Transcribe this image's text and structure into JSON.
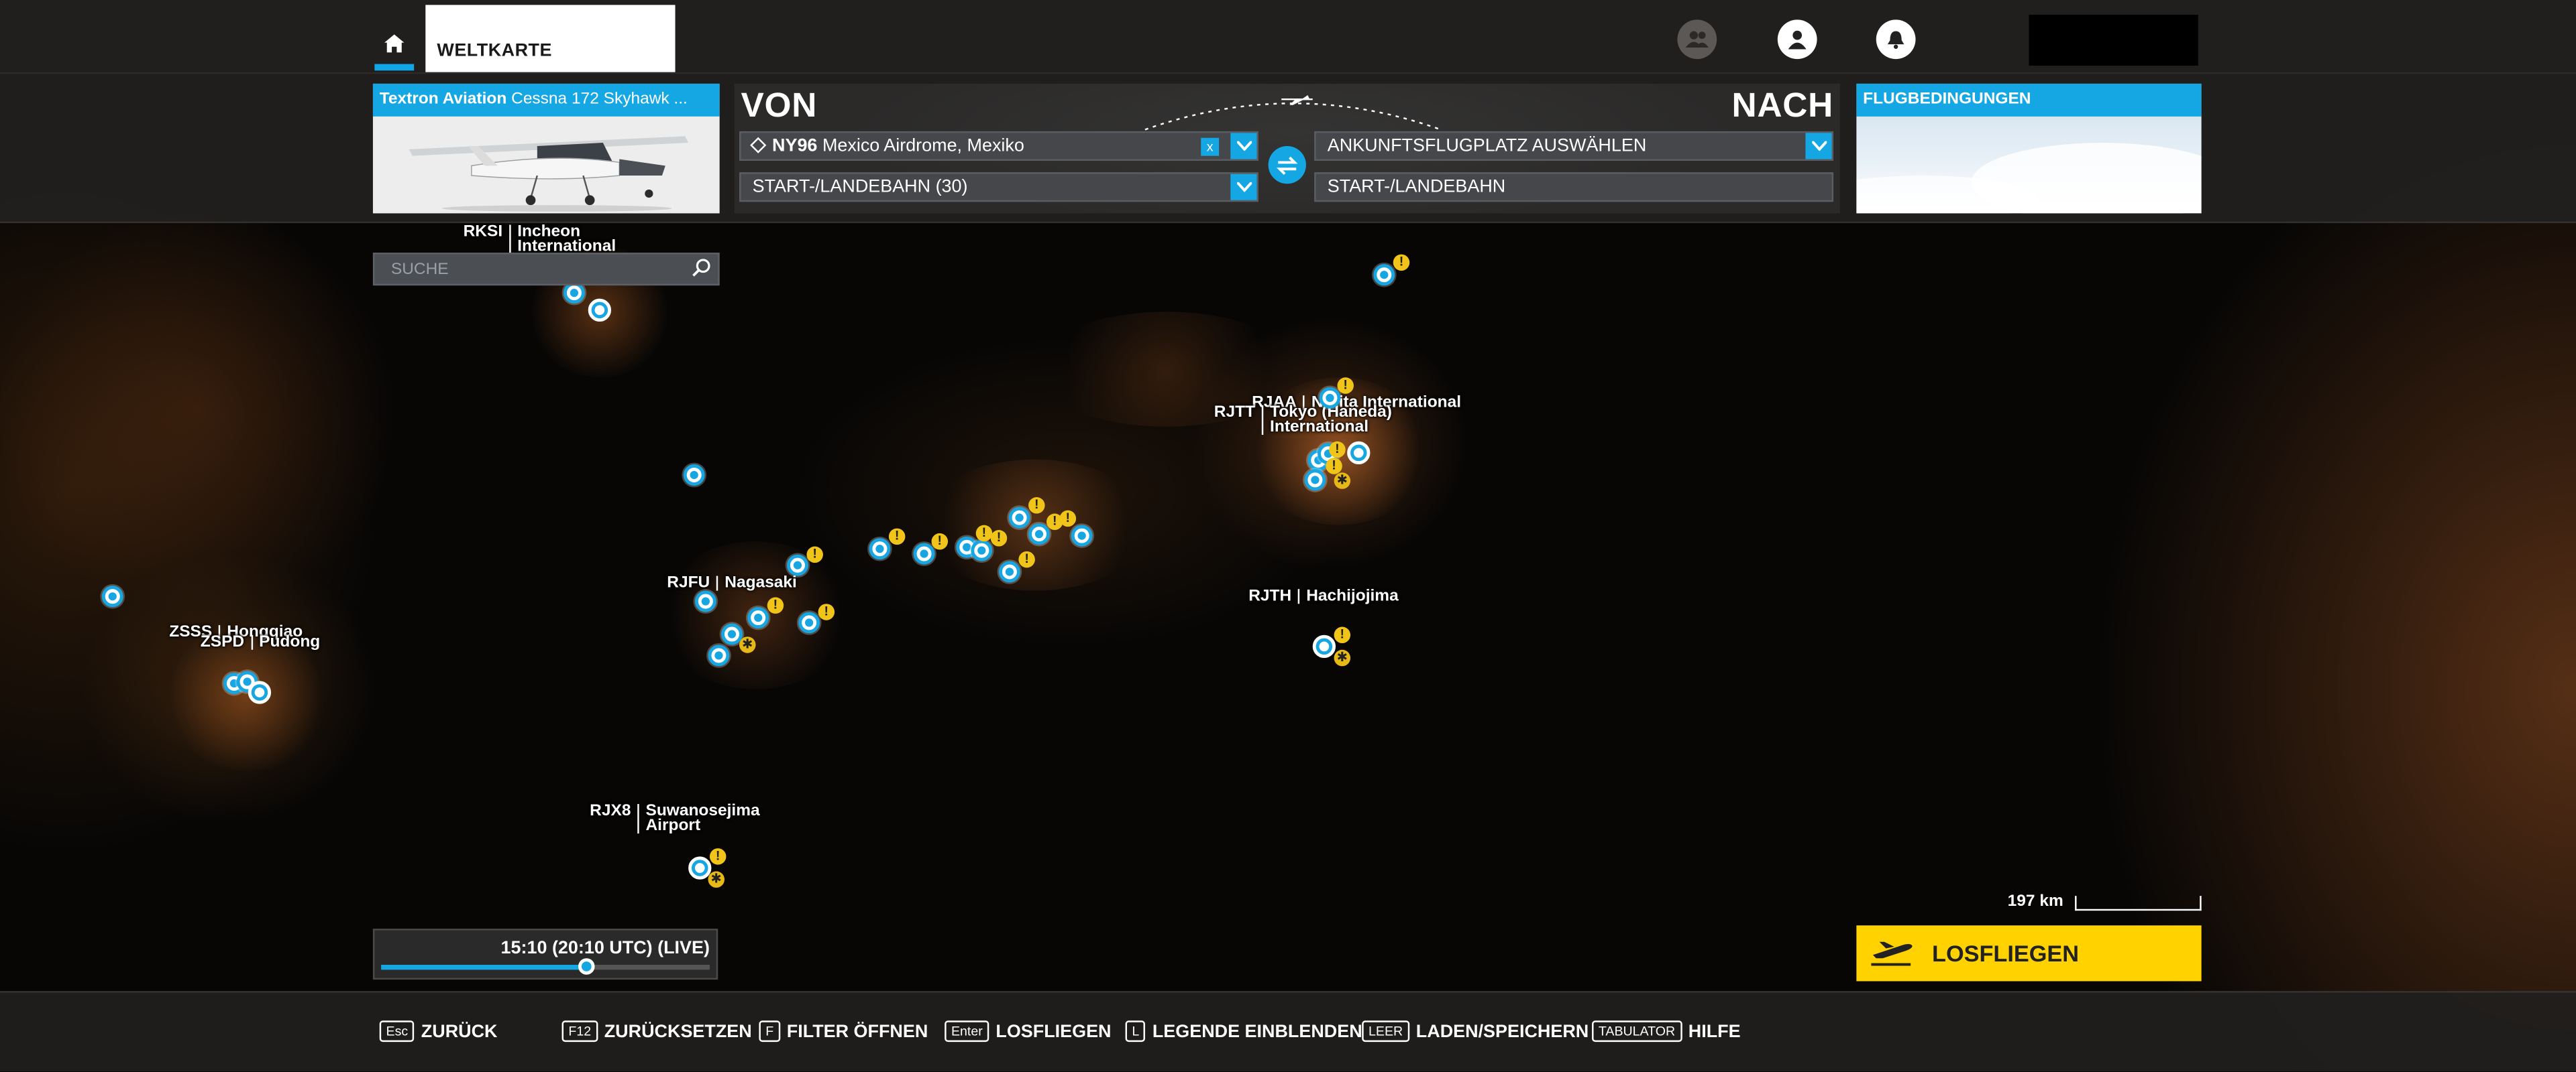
{
  "topbar": {
    "tabs": [
      {
        "label": "WELTKARTE"
      }
    ]
  },
  "aircraft": {
    "maker": "Textron Aviation",
    "model": "Cessna 172 Skyhawk ..."
  },
  "route": {
    "from_label": "VON",
    "to_label": "NACH",
    "departure_code": "NY96",
    "departure_name": "Mexico Airdrome, Mexiko",
    "departure_clear": "x",
    "departure_runway": "START-/LANDEBAHN (30)",
    "arrival_placeholder": "ANKUNFTSFLUGPLATZ AUSWÄHLEN",
    "arrival_runway": "START-/LANDEBAHN"
  },
  "weather": {
    "title": "FLUGBEDINGUNGEN"
  },
  "search": {
    "placeholder": "SUCHE"
  },
  "airports": [
    {
      "code": "RKSI",
      "name1": "Incheon",
      "name2": "International"
    },
    {
      "code": "RJAA",
      "name1": "Narita International",
      "name2": ""
    },
    {
      "code": "RJTT",
      "name1": "Tokyo (Haneda)",
      "name2": "International"
    },
    {
      "code": "RJFU",
      "name1": "Nagasaki",
      "name2": ""
    },
    {
      "code": "ZSSS",
      "name1": "Hongqiao",
      "name2": ""
    },
    {
      "code": "ZSPD",
      "name1": "Pudong",
      "name2": ""
    },
    {
      "code": "RJTH",
      "name1": "Hachijojima",
      "name2": ""
    },
    {
      "code": "RJX8",
      "name1": "Suwanosejima",
      "name2": "Airport"
    }
  ],
  "time": {
    "text": "15:10 (20:10 UTC) (LIVE)",
    "progress": 0.625
  },
  "map_scale": {
    "text": "197 km"
  },
  "fly_button": {
    "label": "LOSFLIEGEN"
  },
  "hints": [
    {
      "key": "Esc",
      "label": "ZURÜCK"
    },
    {
      "key": "F12",
      "label": "ZURÜCKSETZEN"
    },
    {
      "key": "F",
      "label": "FILTER ÖFFNEN"
    },
    {
      "key": "Enter",
      "label": "LOSFLIEGEN"
    },
    {
      "key": "L",
      "label": "LEGENDE EINBLENDEN"
    },
    {
      "key": "LEER",
      "label": "LADEN/SPEICHERN"
    },
    {
      "key": "TABULATOR",
      "label": "HILFE"
    }
  ],
  "markers": {
    "warn_symbol": "!",
    "star_symbol": "✱"
  },
  "colors": {
    "accent": "#15a7e3",
    "fly_button": "#ffd200",
    "warning": "#f0c419"
  }
}
